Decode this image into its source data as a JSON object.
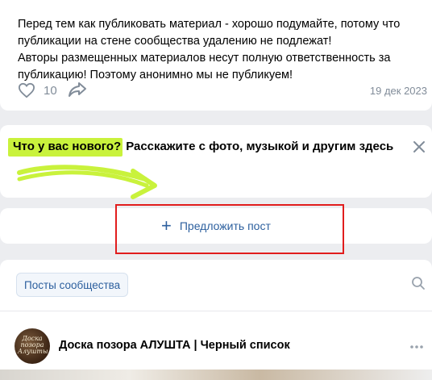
{
  "post": {
    "lines": [
      "Перед тем как публиковать материал - хорошо подумайте, потому что",
      "публикации на стене сообщества удалению не подлежат!",
      "Авторы размещенных материалов несут полную ответственность за",
      "публикацию! Поэтому анонимно мы не публикуем!"
    ],
    "likes": "10",
    "date": "19 дек 2023"
  },
  "new_post": {
    "question": "Что у вас нового?",
    "hint": "Расскажите с фото, музыкой и другим здесь"
  },
  "suggest": {
    "label": "Предложить пост",
    "plus": "+"
  },
  "posts": {
    "chip": "Посты сообщества",
    "group_name": "Доска позора АЛУШТА | Черный список",
    "avatar_text": "Доска позора Алушты"
  },
  "colors": {
    "accent": "#2c5f9e",
    "highlight": "#c9f23c",
    "annotation": "#e11d1d"
  },
  "icons": [
    "heart-icon",
    "share-icon",
    "close-icon",
    "plus-icon",
    "search-icon",
    "more-icon"
  ]
}
